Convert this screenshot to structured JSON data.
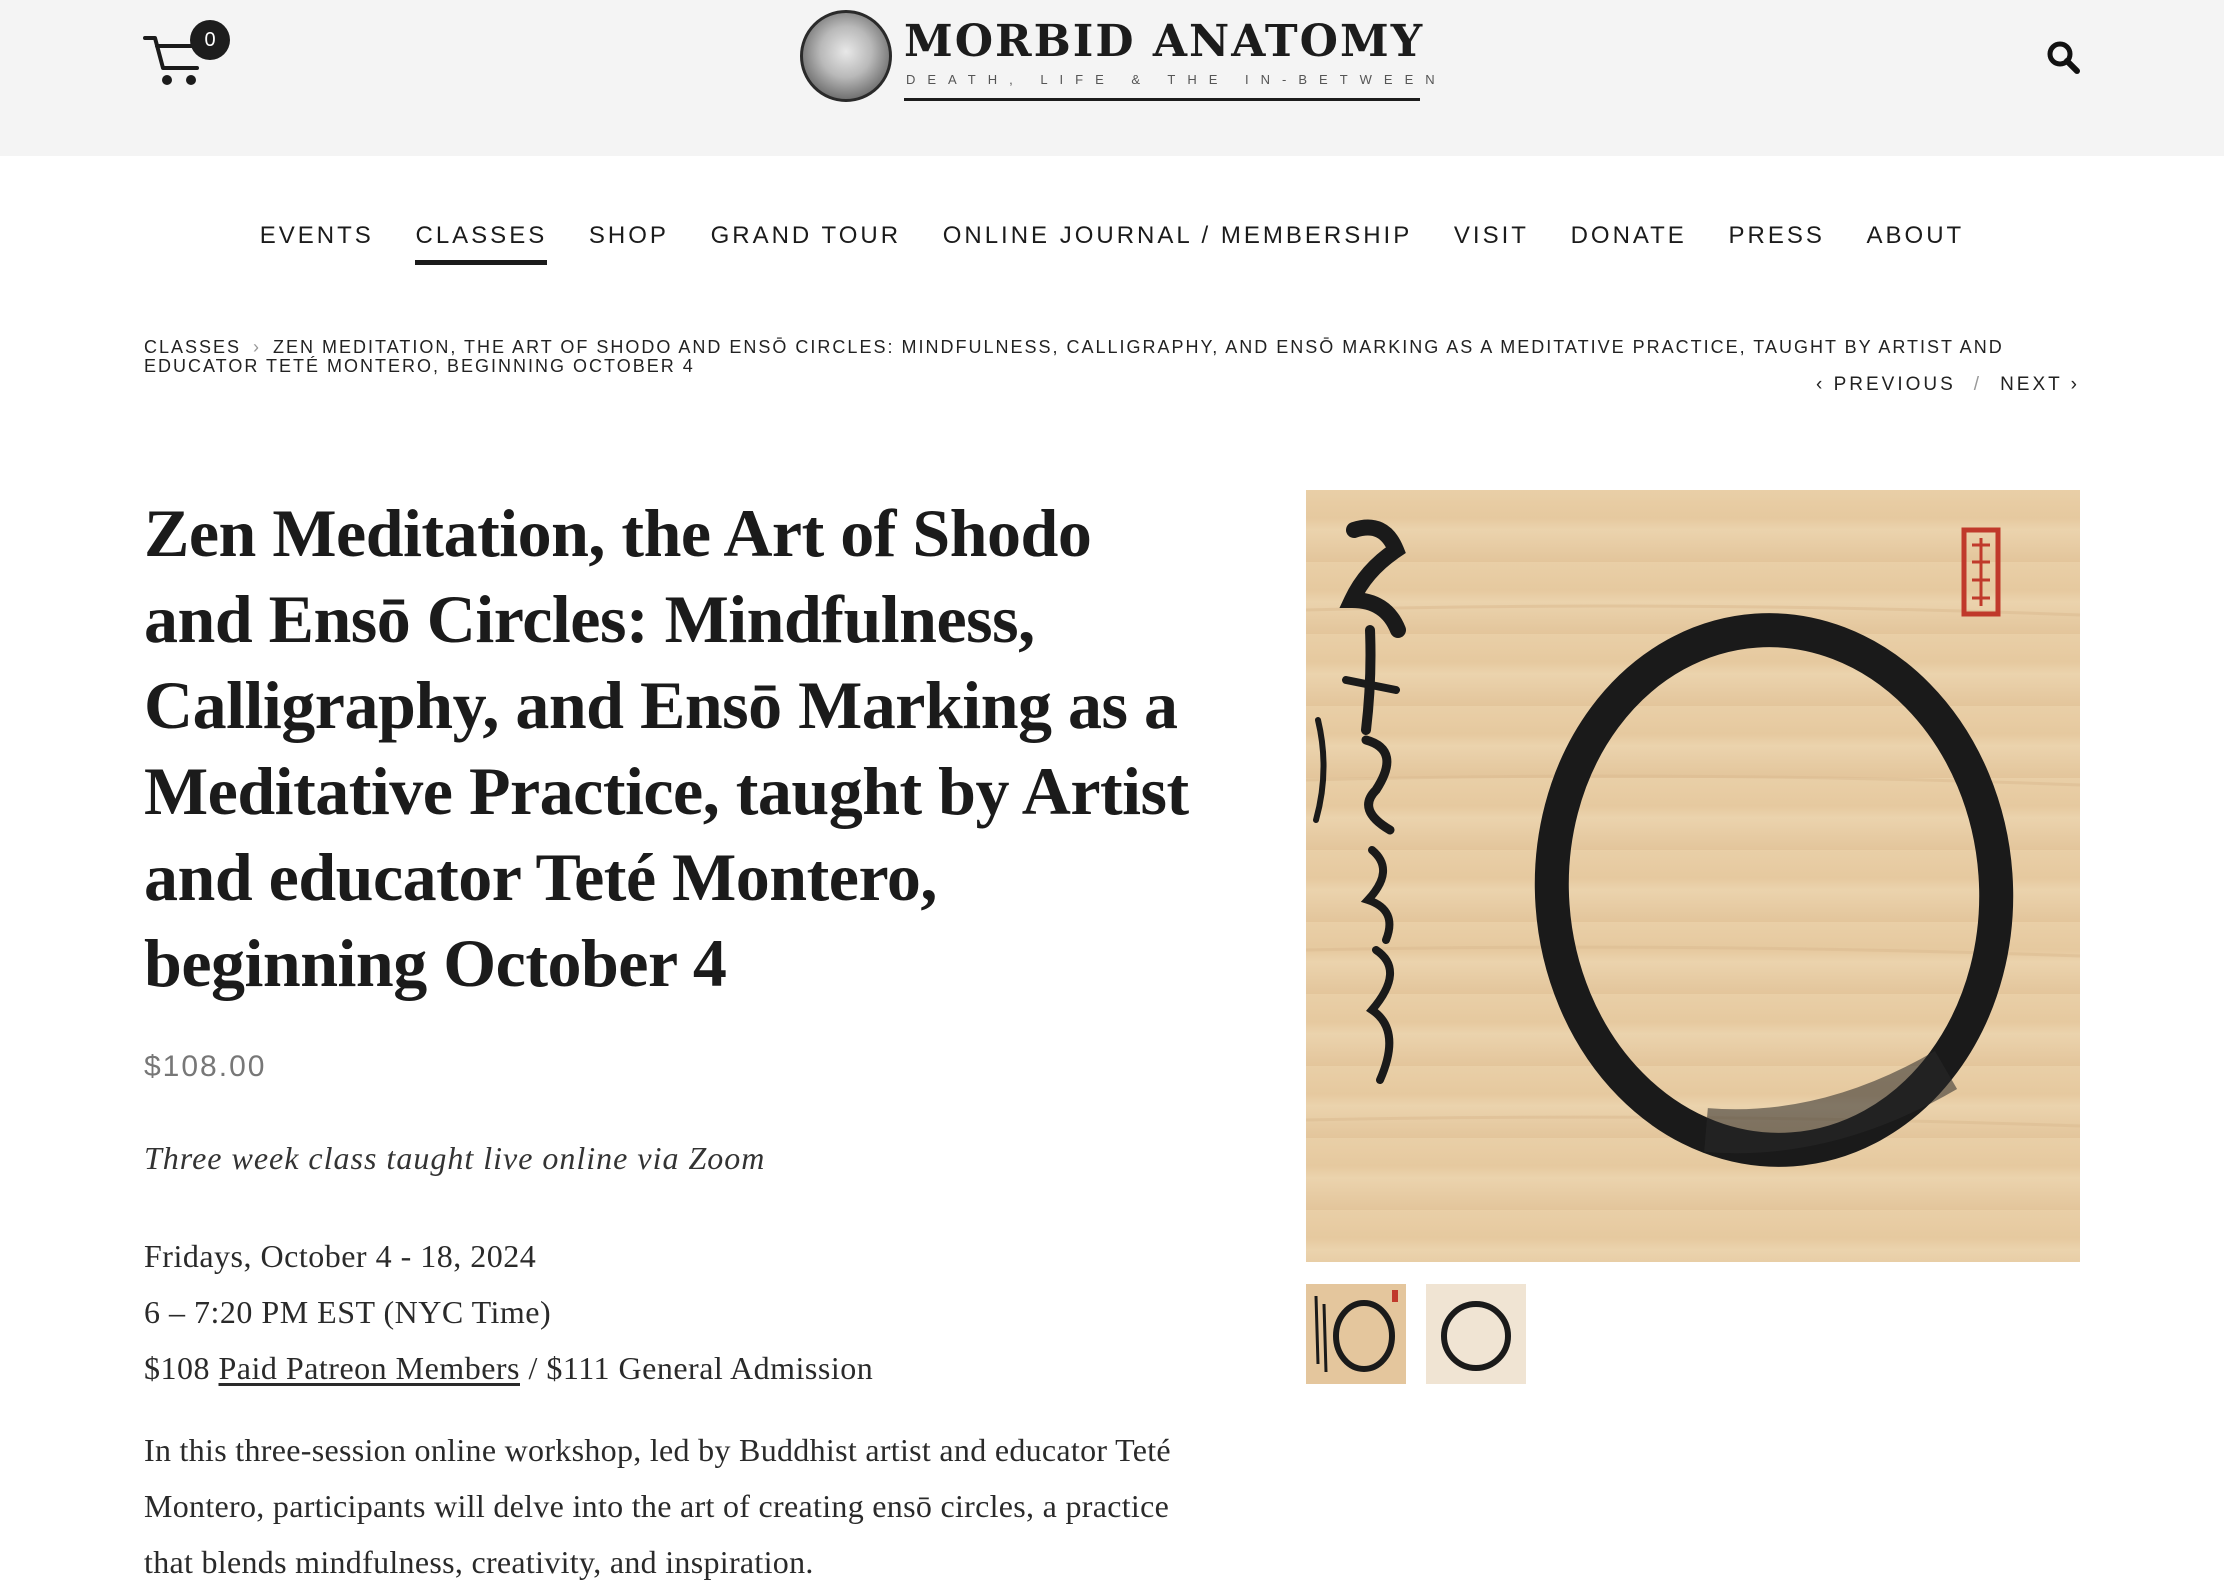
{
  "header": {
    "cart_count": "0",
    "logo_title": "MORBID ANATOMY",
    "logo_tagline": "DEATH, LIFE & THE IN-BETWEEN"
  },
  "nav": {
    "items": [
      "EVENTS",
      "CLASSES",
      "SHOP",
      "GRAND TOUR",
      "ONLINE JOURNAL / MEMBERSHIP",
      "VISIT",
      "DONATE",
      "PRESS",
      "ABOUT"
    ],
    "active": "CLASSES"
  },
  "breadcrumb": {
    "parent": "CLASSES",
    "separator": "›",
    "current": "ZEN MEDITATION, THE ART OF SHODO AND ENSŌ CIRCLES: MINDFULNESS, CALLIGRAPHY, AND ENSŌ MARKING AS A MEDITATIVE PRACTICE, TAUGHT BY ARTIST AND EDUCATOR TETÉ MONTERO, BEGINNING OCTOBER 4"
  },
  "pager": {
    "previous": "‹ PREVIOUS",
    "separator": "/",
    "next": "NEXT ›"
  },
  "product": {
    "title": "Zen Meditation, the Art of Shodo and Ensō Circles: Mindfulness, Calligraphy, and Ensō Marking as a Meditative Practice, taught by Artist and educator Teté Montero, beginning October 4",
    "price": "$108.00",
    "subtitle": "Three week class taught live online via Zoom",
    "date_line": "Fridays, October 4 - 18, 2024",
    "time_line": "6 – 7:20 PM EST (NYC Time)",
    "pricing_prefix": "$108 ",
    "pricing_link": "Paid Patreon Members",
    "pricing_suffix": " / $111 General Admission",
    "description": "In this three-session online workshop, led by Buddhist artist and educator Teté Montero, participants will delve into the art of creating ensō circles, a practice that blends mindfulness, creativity, and inspiration."
  },
  "gallery": {
    "main_image": "enso-calligraphy-scroll",
    "thumbnails": [
      "enso-with-calligraphy-thumbnail",
      "enso-circle-thumbnail"
    ]
  },
  "colors": {
    "header_bg": "#f4f4f4",
    "text": "#1b1b1b",
    "price": "#777777",
    "paper": "#e9cfa7",
    "ink": "#1a1a1a",
    "seal": "#c0392b"
  }
}
